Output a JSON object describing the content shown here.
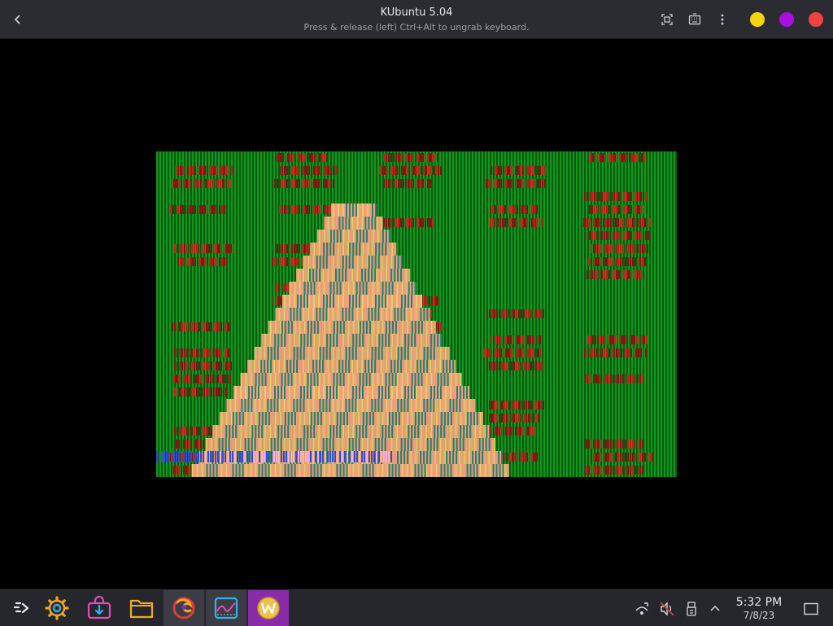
{
  "window": {
    "title": "KUbuntu 5.04",
    "subtitle": "Press & release (left) Ctrl+Alt to ungrab keyboard."
  },
  "titlebar_buttons": {
    "icons": [
      "back-icon",
      "screenshot-icon",
      "keyboard-icon",
      "menu-dots-icon"
    ],
    "window_controls": [
      {
        "name": "minimize",
        "color": "#f5d60e"
      },
      {
        "name": "maximize",
        "color": "#a90fe0"
      },
      {
        "name": "close",
        "color": "#f04444"
      }
    ]
  },
  "vm_screen": {
    "colors": {
      "green": "#0f9a1e",
      "dark_green": "#0a5a10",
      "red": "#b8261a",
      "dark_red": "#7a1a10",
      "peach": "#f0a080",
      "yellow": "#e8d060",
      "teal": "#2a8070",
      "pink": "#ffb0d0",
      "blue": "#3050c0"
    }
  },
  "taskbar": {
    "apps": [
      {
        "name": "application-launcher",
        "icon": "launcher-icon"
      },
      {
        "name": "system-settings",
        "icon": "gear-icon"
      },
      {
        "name": "discover",
        "icon": "software-center-icon"
      },
      {
        "name": "dolphin",
        "icon": "folder-icon"
      },
      {
        "name": "firefox",
        "icon": "firefox-icon"
      },
      {
        "name": "system-monitor",
        "icon": "monitor-icon"
      },
      {
        "name": "vm-app",
        "icon": "w-logo-icon"
      }
    ],
    "tray": [
      "network-icon",
      "muted-volume-icon",
      "usb-icon",
      "expand-tray-icon"
    ],
    "clock": {
      "time": "5:32 PM",
      "date": "7/8/23"
    }
  },
  "colors": {
    "titlebar_bg": "#2b2c31",
    "taskbar_bg": "#25272c",
    "selected_app_bg": "#8a2ba8",
    "icon_blue": "#3daee9",
    "icon_orange": "#f5a623",
    "icon_pink": "#e24db5"
  }
}
